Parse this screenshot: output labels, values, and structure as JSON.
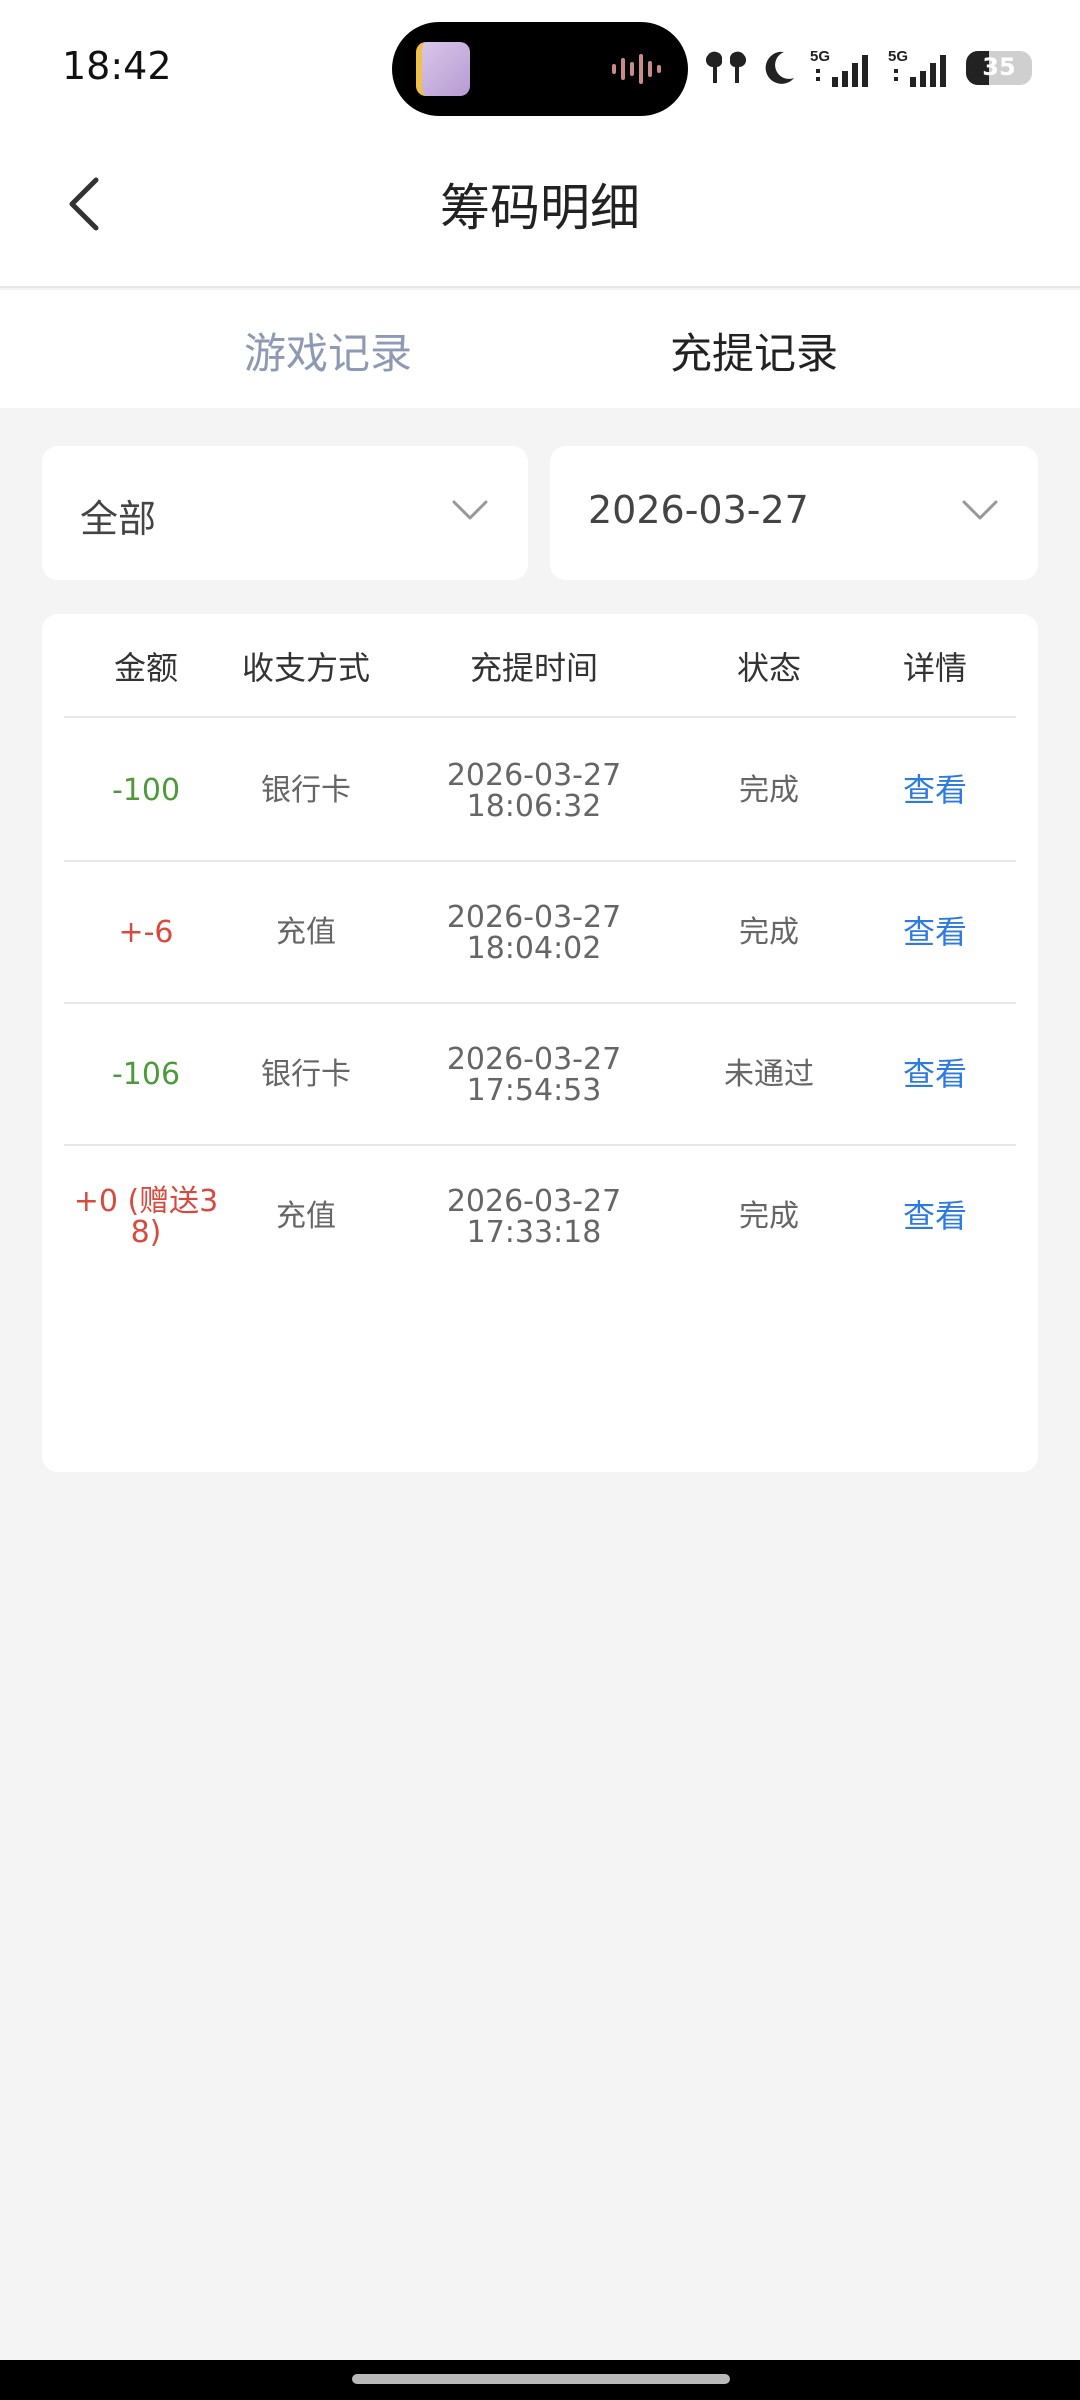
{
  "status_bar": {
    "time": "18:42",
    "battery": "35",
    "battery_level_percent": 35,
    "network_1": "5G",
    "network_2": "5G",
    "icons": [
      "earbuds-icon",
      "moon-icon",
      "signal-5g-icon",
      "signal-5g-icon",
      "battery-icon"
    ]
  },
  "header": {
    "title": "筹码明细",
    "back_icon": "chevron-left-icon"
  },
  "tabs": [
    {
      "label": "游戏记录",
      "active": false
    },
    {
      "label": "充提记录",
      "active": true
    }
  ],
  "filters": {
    "type_value": "全部",
    "date_value": "2026-03-27"
  },
  "table": {
    "headers": [
      "金额",
      "收支方式",
      "充提时间",
      "状态",
      "详情"
    ],
    "rows": [
      {
        "amount": "-100",
        "method": "银行卡",
        "date": "2026-03-27",
        "time": "18:06:32",
        "status": "完成",
        "detail": "查看",
        "sign": "neg"
      },
      {
        "amount": "+-6",
        "method": "充值",
        "date": "2026-03-27",
        "time": "18:04:02",
        "status": "完成",
        "detail": "查看",
        "sign": "pos"
      },
      {
        "amount": "-106",
        "method": "银行卡",
        "date": "2026-03-27",
        "time": "17:54:53",
        "status": "未通过",
        "detail": "查看",
        "sign": "neg"
      },
      {
        "amount_line1": "+0 (赠送3",
        "amount_line2": "8)",
        "method": "充值",
        "date": "2026-03-27",
        "time": "17:33:18",
        "status": "完成",
        "detail": "查看",
        "sign": "pos"
      }
    ]
  },
  "colors": {
    "negative": "#4e9a3a",
    "positive": "#d84a3e",
    "link": "#2d7be0",
    "inactive_tab": "#8e9ab3"
  }
}
